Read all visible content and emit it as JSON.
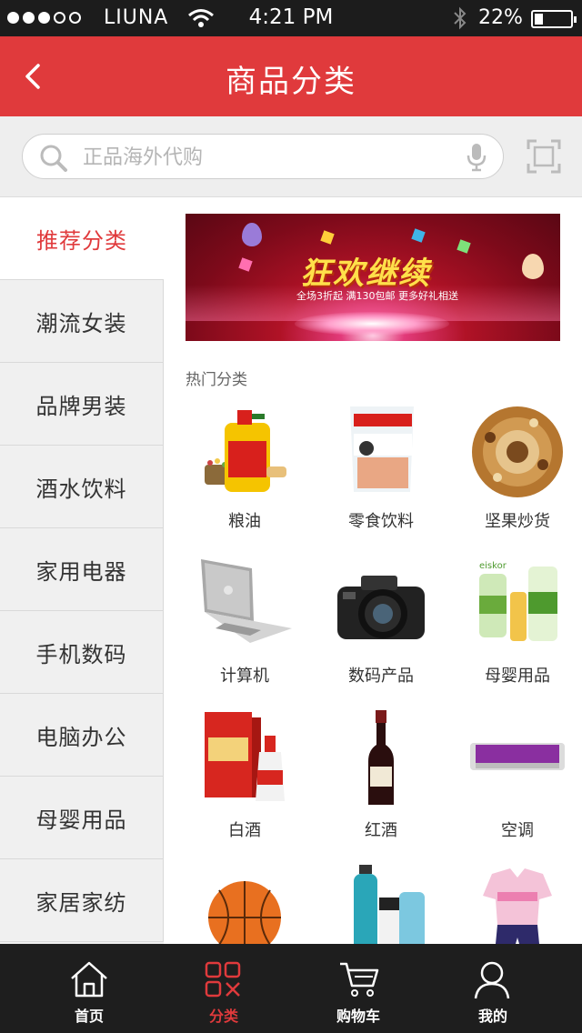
{
  "status_bar": {
    "carrier": "LIUNA",
    "time": "4:21 PM",
    "battery": "22%"
  },
  "header": {
    "title": "商品分类"
  },
  "search": {
    "placeholder": "正品海外代购"
  },
  "sidebar": {
    "items": [
      {
        "label": "推荐分类",
        "active": true
      },
      {
        "label": "潮流女装"
      },
      {
        "label": "品牌男装"
      },
      {
        "label": "酒水饮料"
      },
      {
        "label": "家用电器"
      },
      {
        "label": "手机数码"
      },
      {
        "label": "电脑办公"
      },
      {
        "label": "母婴用品"
      },
      {
        "label": "家居家纺"
      }
    ]
  },
  "banner": {
    "headline": "狂欢继续",
    "tagline": "全场3折起  满130包邮  更多好礼相送"
  },
  "hot": {
    "title": "热门分类",
    "items": [
      {
        "label": "粮油",
        "icon": "cooking-oil-icon"
      },
      {
        "label": "零食饮料",
        "icon": "snack-bag-icon"
      },
      {
        "label": "坚果炒货",
        "icon": "nuts-icon"
      },
      {
        "label": "计算机",
        "icon": "laptop-icon"
      },
      {
        "label": "数码产品",
        "icon": "camera-icon"
      },
      {
        "label": "母婴用品",
        "icon": "baby-products-icon"
      },
      {
        "label": "白酒",
        "icon": "liquor-icon"
      },
      {
        "label": "红酒",
        "icon": "wine-bottle-icon"
      },
      {
        "label": "空调",
        "icon": "air-conditioner-icon"
      },
      {
        "label": "",
        "icon": "basketball-icon"
      },
      {
        "label": "",
        "icon": "cosmetics-icon"
      },
      {
        "label": "",
        "icon": "kids-clothing-icon"
      }
    ]
  },
  "tabbar": {
    "items": [
      {
        "label": "首页",
        "icon": "home-icon"
      },
      {
        "label": "分类",
        "icon": "category-icon",
        "active": true
      },
      {
        "label": "购物车",
        "icon": "cart-icon"
      },
      {
        "label": "我的",
        "icon": "user-icon"
      }
    ]
  },
  "colors": {
    "brand": "#e03a3c",
    "tabbar_bg": "#1e1e1e"
  }
}
